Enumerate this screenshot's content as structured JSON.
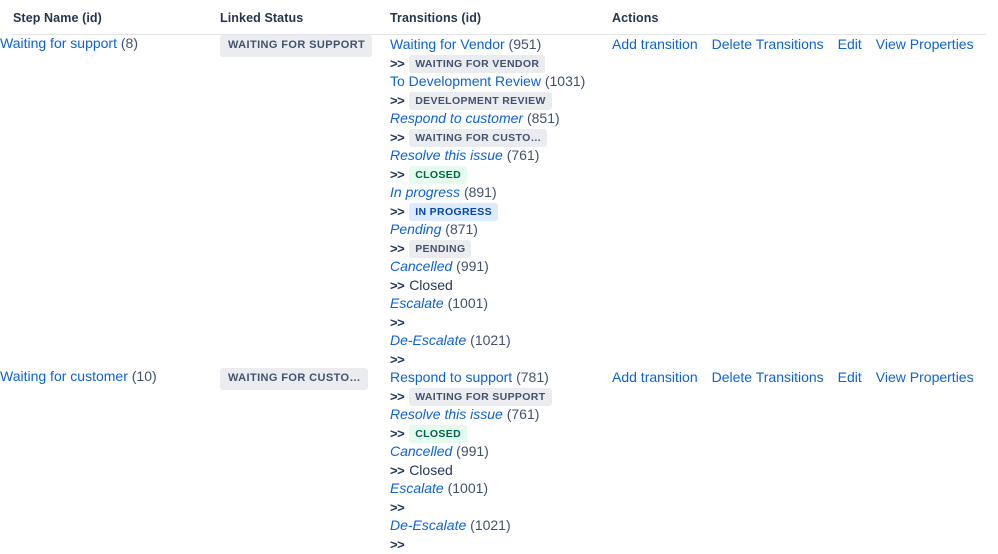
{
  "table": {
    "columns": [
      {
        "key": "step",
        "label": "Step Name (id)"
      },
      {
        "key": "status",
        "label": "Linked Status"
      },
      {
        "key": "trans",
        "label": "Transitions (id)"
      },
      {
        "key": "act",
        "label": "Actions"
      }
    ],
    "actions": [
      {
        "label": "Add transition"
      },
      {
        "label": "Delete Transitions"
      },
      {
        "label": "Edit"
      },
      {
        "label": "View Properties"
      }
    ],
    "rows": [
      {
        "step_name": "Waiting for support",
        "step_id": "(8)",
        "linked_status": "WAITING FOR SUPPORT",
        "transitions": [
          {
            "name": "Waiting for Vendor",
            "id": "(951)",
            "italic": false,
            "target": "WAITING FOR VENDOR",
            "target_style": "lozenge-gray"
          },
          {
            "name": "To Development Review",
            "id": "(1031)",
            "italic": false,
            "target": "DEVELOPMENT REVIEW",
            "target_style": "lozenge-gray"
          },
          {
            "name": "Respond to customer",
            "id": "(851)",
            "italic": true,
            "target": "WAITING FOR CUSTO…",
            "target_style": "lozenge-gray"
          },
          {
            "name": "Resolve this issue",
            "id": "(761)",
            "italic": true,
            "target": "CLOSED",
            "target_style": "lozenge-green"
          },
          {
            "name": "In progress",
            "id": "(891)",
            "italic": true,
            "target": "IN PROGRESS",
            "target_style": "lozenge-blue"
          },
          {
            "name": "Pending",
            "id": "(871)",
            "italic": true,
            "target": "PENDING",
            "target_style": "lozenge-gray"
          },
          {
            "name": "Cancelled",
            "id": "(991)",
            "italic": true,
            "target": "Closed",
            "target_style": "plain"
          },
          {
            "name": "Escalate",
            "id": "(1001)",
            "italic": true,
            "target": "",
            "target_style": "empty"
          },
          {
            "name": "De-Escalate",
            "id": "(1021)",
            "italic": true,
            "target": "",
            "target_style": "empty"
          }
        ]
      },
      {
        "step_name": "Waiting for customer",
        "step_id": "(10)",
        "linked_status": "WAITING FOR CUSTO…",
        "transitions": [
          {
            "name": "Respond to support",
            "id": "(781)",
            "italic": false,
            "target": "WAITING FOR SUPPORT",
            "target_style": "lozenge-gray"
          },
          {
            "name": "Resolve this issue",
            "id": "(761)",
            "italic": true,
            "target": "CLOSED",
            "target_style": "lozenge-green"
          },
          {
            "name": "Cancelled",
            "id": "(991)",
            "italic": true,
            "target": "Closed",
            "target_style": "plain"
          },
          {
            "name": "Escalate",
            "id": "(1001)",
            "italic": true,
            "target": "",
            "target_style": "empty"
          },
          {
            "name": "De-Escalate",
            "id": "(1021)",
            "italic": true,
            "target": "",
            "target_style": "empty"
          }
        ]
      }
    ],
    "arrow_glyph": ">>"
  },
  "colors": {
    "link": "#0d63d6",
    "header_text": "#26354f",
    "id_text": "#42526e",
    "rule": "#e3e5e9",
    "lozenge_gray_bg": "#ebecf0",
    "lozenge_gray_text": "#42526e",
    "lozenge_green_bg": "#e3fcef",
    "lozenge_green_text": "#006644",
    "lozenge_blue_bg": "#deebff",
    "lozenge_blue_text": "#0747a6"
  }
}
